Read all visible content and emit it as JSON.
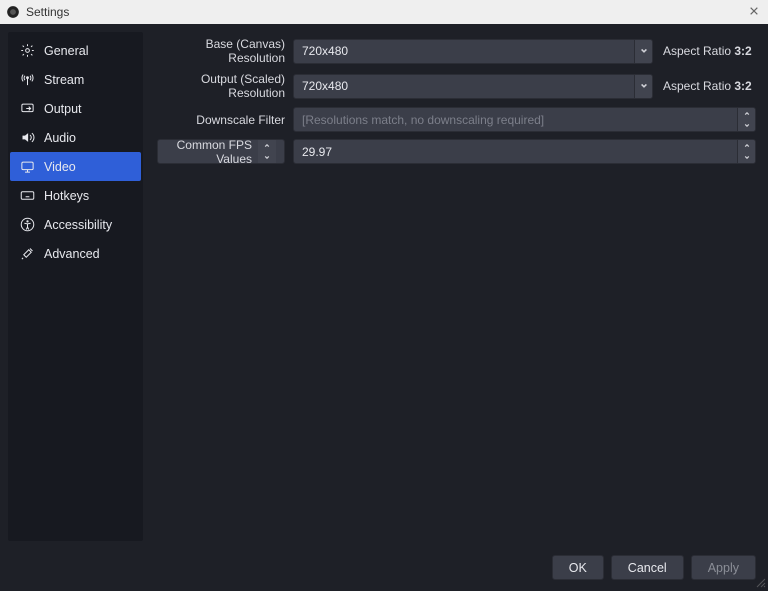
{
  "window": {
    "title": "Settings"
  },
  "sidebar": {
    "items": [
      {
        "label": "General"
      },
      {
        "label": "Stream"
      },
      {
        "label": "Output"
      },
      {
        "label": "Audio"
      },
      {
        "label": "Video"
      },
      {
        "label": "Hotkeys"
      },
      {
        "label": "Accessibility"
      },
      {
        "label": "Advanced"
      }
    ]
  },
  "video": {
    "base_label": "Base (Canvas) Resolution",
    "base_value": "720x480",
    "base_aspect_label": "Aspect Ratio ",
    "base_aspect_value": "3:2",
    "output_label": "Output (Scaled) Resolution",
    "output_value": "720x480",
    "output_aspect_label": "Aspect Ratio ",
    "output_aspect_value": "3:2",
    "downscale_label": "Downscale Filter",
    "downscale_value": "[Resolutions match, no downscaling required]",
    "fps_mode_label": "Common FPS Values",
    "fps_value": "29.97"
  },
  "footer": {
    "ok": "OK",
    "cancel": "Cancel",
    "apply": "Apply"
  }
}
